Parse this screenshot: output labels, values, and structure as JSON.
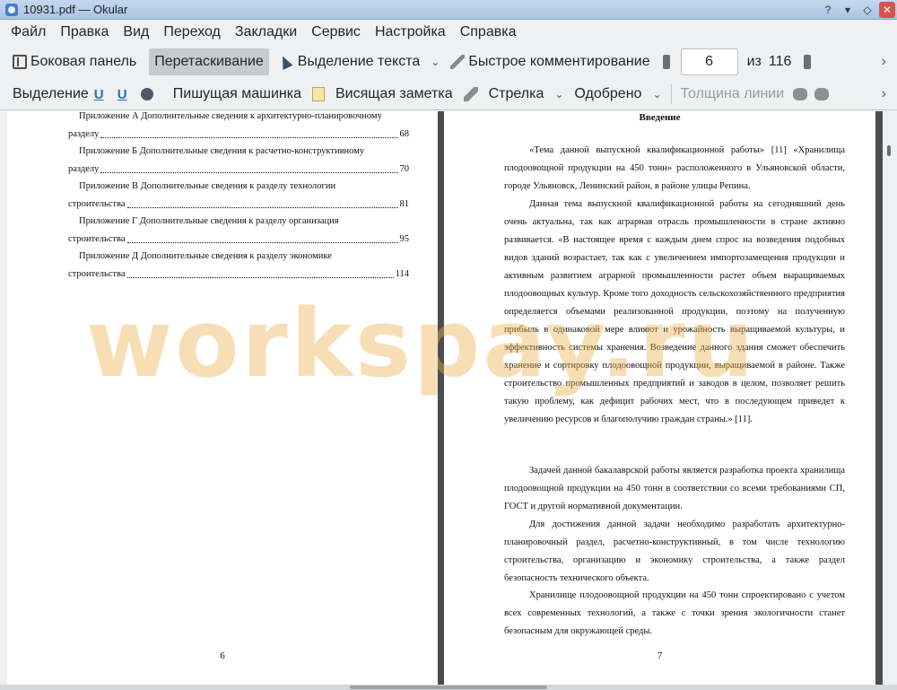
{
  "window": {
    "title": "10931.pdf  — Okular"
  },
  "menu": [
    "Файл",
    "Правка",
    "Вид",
    "Переход",
    "Закладки",
    "Сервис",
    "Настройка",
    "Справка"
  ],
  "toolbar1": {
    "sidebar_label": "Боковая панель",
    "drag_label": "Перетаскивание",
    "select_text_label": "Выделение текста",
    "quick_comment_label": "Быстрое комментирование",
    "page_current": "6",
    "page_of": "из",
    "page_total": "116"
  },
  "toolbar2": {
    "selection_label": "Выделение",
    "typewriter_label": "Пишущая машинка",
    "sticky_note_label": "Висящая заметка",
    "arrow_label": "Стрелка",
    "stamp_label": "Одобрено",
    "line_width_label": "Толщина линии"
  },
  "left_page": {
    "toc": [
      {
        "title": "Приложение А Дополнительные сведения к архитектурно-планировочному",
        "cont": "разделу",
        "page": "68"
      },
      {
        "title": "Приложение Б Дополнительные сведения к расчетно-конструктивному",
        "cont": "разделу",
        "page": "70"
      },
      {
        "title": "Приложение В Дополнительные сведения к разделу технологии",
        "cont": "строительства",
        "page": "81"
      },
      {
        "title": "Приложение Г Дополнительные сведения к разделу организация",
        "cont": "строительства",
        "page": "95"
      },
      {
        "title": "Приложение Д Дополнительные сведения к разделу экономике",
        "cont": "строительства",
        "page": "114"
      }
    ],
    "page_number": "6"
  },
  "right_page": {
    "heading": "Введение",
    "paragraphs": [
      "«Тема данной выпускной квалификационной работы» [11] «Хранилища плодоовощной продукции на 450 тонн» расположенного в Ульяновской области, городе Ульяновск, Ленинский район, в районе улицы Репина.",
      "Данная тема выпускной квалификационной работы на сегодняшний день очень актуальна, так как аграрная отрасль промышленности в стране активно развивается. «В настоящее время с каждым днем спрос на возведения подобных видов зданий возрастает, так как с увеличением импортозамещения продукции и активным развитием аграрной промышленности растет объем выращиваемых плодоовощных культур. Кроме того доходность сельскохозяйственного предприятия определяется объемами реализованной продукции, поэтому на полученную прибыль в одинаковой мере влияют и урожайность выращиваемой культуры, и эффективность системы хранения. Возведение данного здания сможет обеспечить хранение и сортировку плодоовощной продукции, выращиваемой в районе. Также строительство промышленных предприятий и заводов в целом, позволяет решить такую проблему, как дефицит рабочих мест, что в последующем приведет к увеличению ресурсов и благополучию граждан страны.» [11].",
      "Задачей данной бакалаврской работы является разработка проекта хранилища плодоовощной продукции на 450 тонн в соответствии со всеми требованиями СП, ГОСТ и другой нормативной документации.",
      "Для достижения данной задачи необходимо разработать архитектурно-планировочный раздел, расчетно-конструктивный, в том числе технологию строительства, организацию и экономику строительства, а также раздел безопасность технического объекта.",
      "Хранилище плодоовощной продукции на 450 тонн спроектировано с учетом всех современных технологий, а также с точки зрения экологичности станет безопасным для окружающей среды."
    ],
    "page_number": "7"
  },
  "watermark": "workspay.ru"
}
